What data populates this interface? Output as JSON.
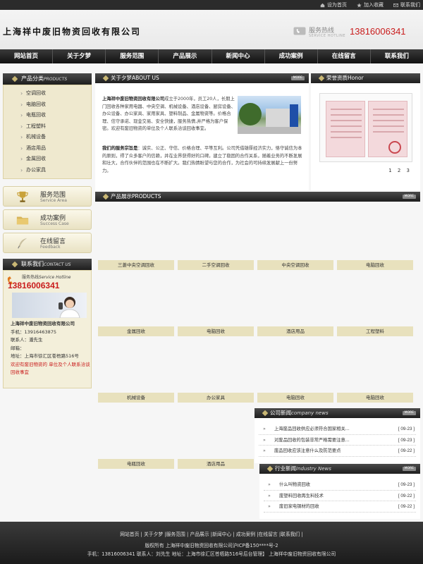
{
  "toplinks": [
    "设为首页",
    "加入收藏",
    "联系我们"
  ],
  "header": {
    "company": "上海祥中废旧物资回收有限公司",
    "hotline_label": "服务热线",
    "hotline_sub": "SERVICE HOTLINE",
    "hotline_number": "13816006341"
  },
  "nav": [
    "网站首页",
    "关于夕梦",
    "服务范围",
    "产品展示",
    "新闻中心",
    "成功案例",
    "在线留言",
    "联系我们"
  ],
  "categories": {
    "title": "产品分类",
    "title_en": "PRODUCTS",
    "items": [
      "空调回收",
      "电脑回收",
      "电瓶回收",
      "工程塑料",
      "机械设备",
      "酒店用品",
      "金属回收",
      "办公家具"
    ]
  },
  "services": [
    {
      "title": "服务范围",
      "sub": "Service Area"
    },
    {
      "title": "成功案例",
      "sub": "Success Case"
    },
    {
      "title": "在线留言",
      "sub": "Feedback"
    }
  ],
  "contact": {
    "title": "联系我们",
    "title_en": "CONTACT US",
    "hotline_label": "服务热线",
    "hotline_label_en": "Service Hotline",
    "hotline_number": "13816006341",
    "company": "上海祥中废旧物资回收有限公司",
    "phone": "手机：13916463875",
    "person": "联系人：潘先生",
    "email": "邮箱：",
    "address": "地址：上海市徐汇区苍梧路516号",
    "welcome": "欢迎有废旧物资的 单位及个人联系洽谈回收事宜"
  },
  "about": {
    "title": "关于夕梦",
    "title_en": "ABOUT US",
    "more": "MORE",
    "company_bold": "上海祥中废旧物资回收有限公司",
    "p1": "成立于2000年，员工20人，长期上门回收各种家用电器、中央空调、机械设备、酒店设备、厨房设备、办公设备、办公家具、家用家具、塑料制品、金属物资等。价格合理、信守承诺、现金交易、安全快捷，服务热情,并严格为客户保密。欢迎有废旧物资的单位及个人联系洽谈回收事宜。",
    "purpose_bold": "我们的服务宗旨是",
    "p2": "：诚实、公正、守信、价格合理、平等互利。公司凭借雄厚经济实力，恪守诚信为本的原则，得了众多客户的信赖，并在业界获得好的口碑。建立了稳固的合作关系，随着业务的不断发展和壮大，合作伙伴的范围也在不断扩大。我们热情盼望与您的合作，为社会的可持续发展献上一份努力。"
  },
  "honor": {
    "title": "荣誉资质",
    "title_en": "Honor",
    "pager": "1 2 3"
  },
  "products": {
    "title": "产品展示",
    "title_en": "PRODUCTS",
    "more": "MORE",
    "rows": [
      [
        "三菱中央空调回收",
        "二手空调回收",
        "中央空调回收",
        "电脑回收"
      ],
      [
        "金属回收",
        "电脑回收",
        "酒店用品",
        "工程塑料"
      ],
      [
        "机械设备",
        "办公家具",
        "电脑回收",
        "电脑回收"
      ],
      [
        "电瓶回收",
        "酒店用品"
      ]
    ]
  },
  "company_news": {
    "title": "公司新闻",
    "title_en": "company news",
    "more": "MORE",
    "items": [
      {
        "text": "上海废品回收供应必须符合国家相关...",
        "date": "[ 09-23 ]"
      },
      {
        "text": "对废品回收的包装非常严格需要注意...",
        "date": "[ 09-23 ]"
      },
      {
        "text": "废品回收应该注意什么及防范要点",
        "date": "[ 09-22 ]"
      }
    ]
  },
  "industry_news": {
    "title": "行业新闻",
    "title_en": "Industry News",
    "more": "MORE",
    "items": [
      {
        "text": "什么叫物资回收",
        "date": "[ 09-23 ]"
      },
      {
        "text": "废塑料回收再生料技术",
        "date": "[ 09-22 ]"
      },
      {
        "text": "废旧家电钢材的回收",
        "date": "[ 09-22 ]"
      }
    ]
  },
  "footer": {
    "links": "网站首页 | 关于夕梦 |服务范围 | 产品展示 |新闻中心 | 成功案例 |在线留言 |联系我们 |",
    "copyright": "版权所有 上海祥中废旧物资回收有限公司沪ICP备150****号-2",
    "contact": "手机：13816006341 联系人：刘先生 地址：上海市徐汇区苍梧路516号后台管理】 上海祥中废旧物资回收有限公司"
  }
}
